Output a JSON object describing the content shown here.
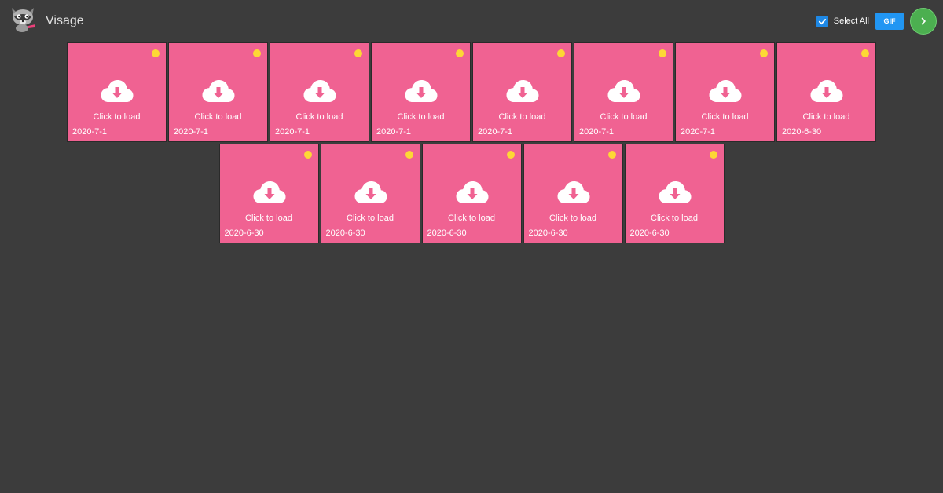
{
  "app": {
    "title": "Visage",
    "logo_icon": "raccoon-mascot-icon"
  },
  "toolbar": {
    "select_all_label": "Select All",
    "select_all_checked": true,
    "gif_label": "GIF",
    "next_icon": "chevron-right-icon"
  },
  "colors": {
    "background": "#3c3c3c",
    "tile": "#f06292",
    "status_dot": "#fdd835",
    "checkbox": "#1e88e5",
    "gif_button": "#2196f3",
    "next_button": "#4caf50"
  },
  "tiles": [
    {
      "label": "Click to load",
      "date": "2020-7-1"
    },
    {
      "label": "Click to load",
      "date": "2020-7-1"
    },
    {
      "label": "Click to load",
      "date": "2020-7-1"
    },
    {
      "label": "Click to load",
      "date": "2020-7-1"
    },
    {
      "label": "Click to load",
      "date": "2020-7-1"
    },
    {
      "label": "Click to load",
      "date": "2020-7-1"
    },
    {
      "label": "Click to load",
      "date": "2020-7-1"
    },
    {
      "label": "Click to load",
      "date": "2020-6-30"
    },
    {
      "label": "Click to load",
      "date": "2020-6-30"
    },
    {
      "label": "Click to load",
      "date": "2020-6-30"
    },
    {
      "label": "Click to load",
      "date": "2020-6-30"
    },
    {
      "label": "Click to load",
      "date": "2020-6-30"
    },
    {
      "label": "Click to load",
      "date": "2020-6-30"
    }
  ]
}
